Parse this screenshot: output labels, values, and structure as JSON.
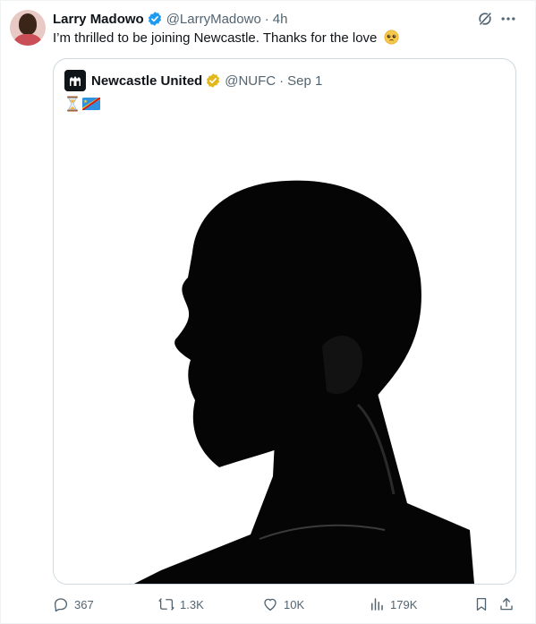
{
  "tweet": {
    "display_name": "Larry Madowo",
    "handle": "@LarryMadowo",
    "separator": "·",
    "time": "4h",
    "text": "I’m thrilled to be joining Newcastle. Thanks for the love",
    "text_emoji": "pleading-face-emoji"
  },
  "quoted": {
    "display_name": "Newcastle United",
    "handle": "@NUFC",
    "separator": "·",
    "date": "Sep 1",
    "emojis": [
      "hourglass-emoji",
      "dr-congo-flag-emoji"
    ],
    "media": "silhouette-photo"
  },
  "actions": {
    "replies": "367",
    "reposts": "1.3K",
    "likes": "10K",
    "views": "179K"
  },
  "colors": {
    "verified_blue": "#1d9bf0",
    "gold_badge": "#e2b719",
    "secondary_text": "#536471",
    "border": "#cfd9de"
  }
}
